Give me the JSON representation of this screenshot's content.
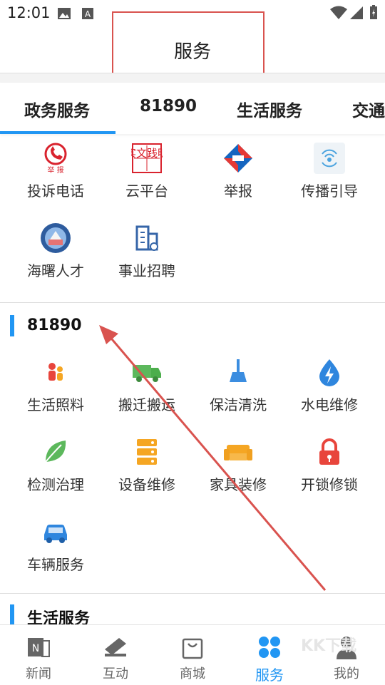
{
  "status": {
    "time": "12:01"
  },
  "header": {
    "title": "服务"
  },
  "tabs": [
    {
      "label": "政务服务",
      "active": true
    },
    {
      "label": "81890",
      "active": false
    },
    {
      "label": "生活服务",
      "active": false
    },
    {
      "label": "交通",
      "active": false
    }
  ],
  "gov_items": [
    {
      "label": "投诉电话",
      "icon": "report-phone-icon"
    },
    {
      "label": "云平台",
      "icon": "wenming-seal-icon"
    },
    {
      "label": "举报",
      "icon": "report-logo-icon"
    },
    {
      "label": "传播引导",
      "icon": "broadcast-icon"
    },
    {
      "label": "海曙人才",
      "icon": "talent-icon"
    },
    {
      "label": "事业招聘",
      "icon": "building-icon"
    }
  ],
  "icon_texts": {
    "report_phone": "举 报",
    "seal": "实文践明"
  },
  "section_81890": {
    "title": "81890",
    "items": [
      {
        "label": "生活照料",
        "icon": "care-icon"
      },
      {
        "label": "搬迁搬运",
        "icon": "truck-icon"
      },
      {
        "label": "保洁清洗",
        "icon": "broom-icon"
      },
      {
        "label": "水电维修",
        "icon": "water-electric-icon"
      },
      {
        "label": "检测治理",
        "icon": "leaf-icon"
      },
      {
        "label": "设备维修",
        "icon": "equipment-icon"
      },
      {
        "label": "家具装修",
        "icon": "sofa-icon"
      },
      {
        "label": "开锁修锁",
        "icon": "lock-icon"
      },
      {
        "label": "车辆服务",
        "icon": "car-icon"
      }
    ]
  },
  "section_life": {
    "title": "生活服务"
  },
  "bottom_nav": [
    {
      "label": "新闻",
      "icon": "news-icon"
    },
    {
      "label": "互动",
      "icon": "interact-icon"
    },
    {
      "label": "商城",
      "icon": "shopping-bag-icon"
    },
    {
      "label": "服务",
      "icon": "service-icon",
      "active": true
    },
    {
      "label": "我的",
      "icon": "profile-icon"
    }
  ],
  "colors": {
    "accent": "#2196f3",
    "annotation": "#d9534f",
    "orange": "#f5a623",
    "red": "#e8453c",
    "green": "#5cb85c"
  },
  "watermark": "KK下载"
}
